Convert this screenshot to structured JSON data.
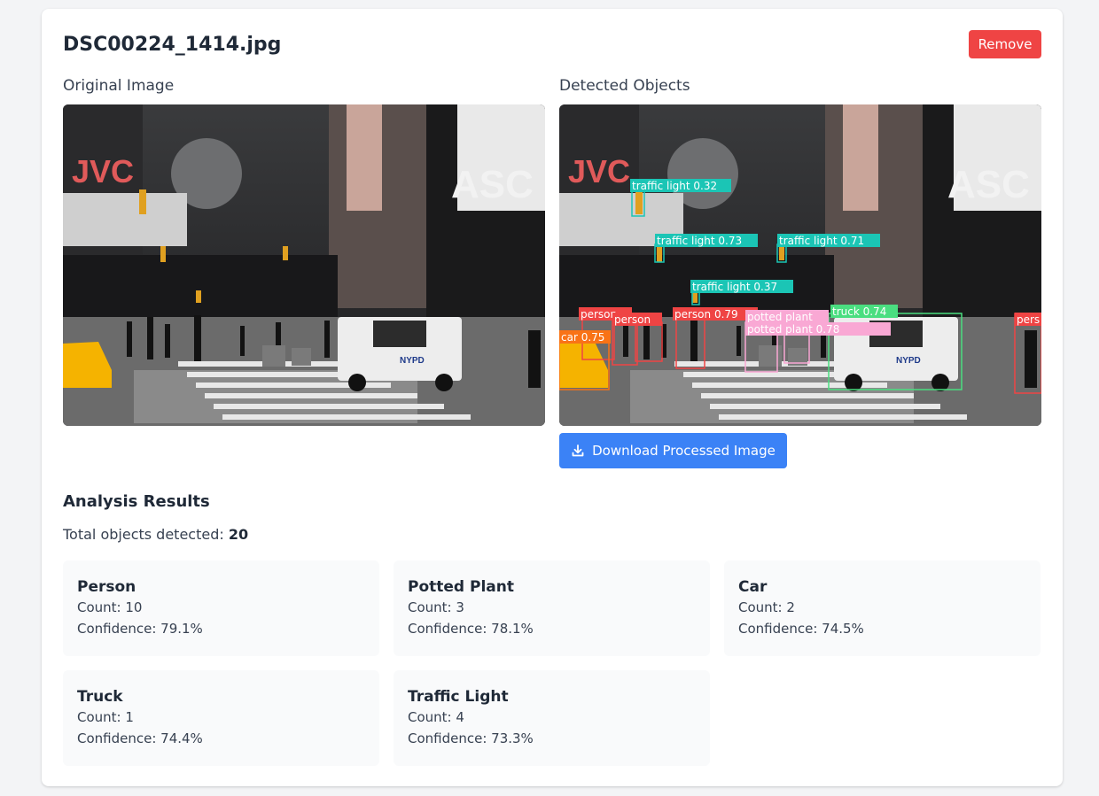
{
  "file": {
    "name": "DSC00224_1414.jpg",
    "remove_label": "Remove"
  },
  "panels": {
    "original_label": "Original Image",
    "detected_label": "Detected Objects"
  },
  "actions": {
    "download_label": "Download Processed Image"
  },
  "results": {
    "title": "Analysis Results",
    "total_prefix": "Total objects detected: ",
    "total_count": "20",
    "stats": [
      {
        "name": "Person",
        "count": "Count: 10",
        "confidence": "Confidence: 79.1%"
      },
      {
        "name": "Potted Plant",
        "count": "Count: 3",
        "confidence": "Confidence: 78.1%"
      },
      {
        "name": "Car",
        "count": "Count: 2",
        "confidence": "Confidence: 74.5%"
      },
      {
        "name": "Truck",
        "count": "Count: 1",
        "confidence": "Confidence: 74.4%"
      },
      {
        "name": "Traffic Light",
        "count": "Count: 4",
        "confidence": "Confidence: 73.3%"
      }
    ]
  },
  "scene_text": {
    "brand_sign": "JVC",
    "billboard": "ASC",
    "taxi_side": "NYPD"
  },
  "detections": {
    "labels": [
      "traffic light 0.32",
      "traffic light 0.73",
      "traffic light 0.71",
      "traffic light 0.37",
      "person",
      "person",
      "person 0.79",
      "potted plant",
      "truck 0.74",
      "potted plant 0.78",
      "car 0.75",
      "pers"
    ]
  },
  "colors": {
    "remove": "#ef4444",
    "download": "#3b82f6",
    "traffic_light": "#1bc5b5",
    "person": "#ef4444",
    "potted_plant": "#f9a8d4",
    "truck": "#4ade80",
    "car": "#f97316"
  }
}
